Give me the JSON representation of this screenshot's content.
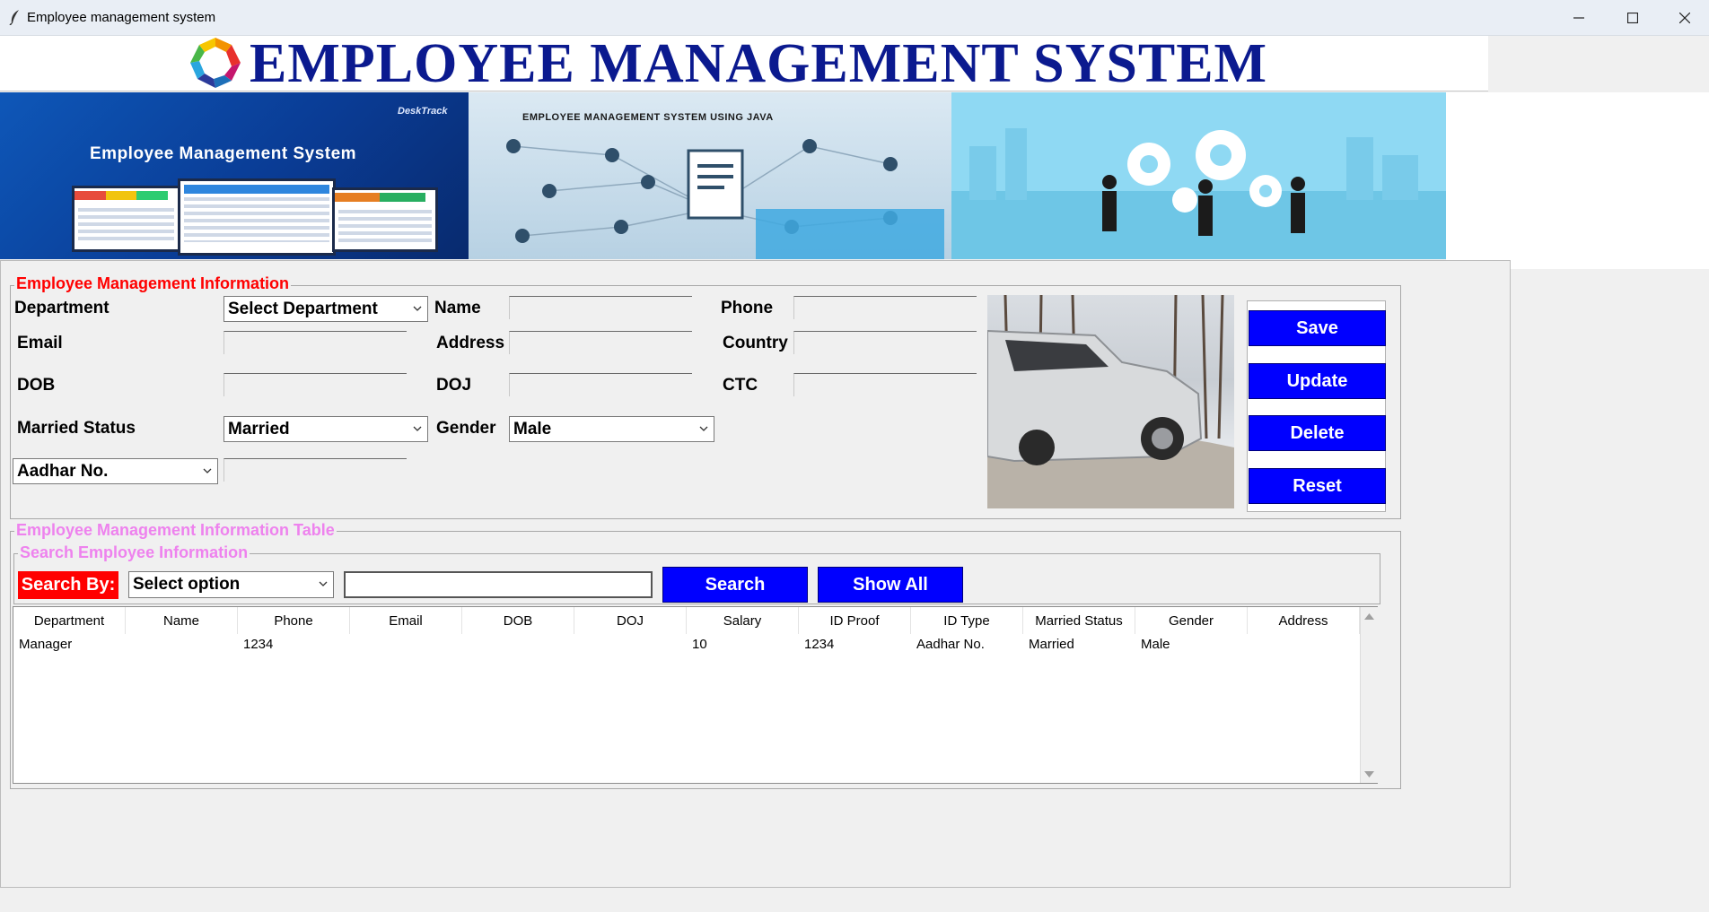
{
  "window": {
    "title": "Employee management system",
    "controls": [
      "minimize",
      "maximize",
      "close"
    ]
  },
  "header": {
    "title": "EMPLOYEE MANAGEMENT SYSTEM"
  },
  "banners": {
    "banner1_caption": "Employee Management System",
    "banner1_brand": "DeskTrack",
    "banner2_caption": "EMPLOYEE MANAGEMENT SYSTEM USING JAVA"
  },
  "form": {
    "legend": "Employee Management Information",
    "labels": {
      "department": "Department",
      "name": "Name",
      "phone": "Phone",
      "email": "Email",
      "address": "Address",
      "country": "Country",
      "dob": "DOB",
      "doj": "DOJ",
      "ctc": "CTC",
      "married_status": "Married Status",
      "gender": "Gender"
    },
    "values": {
      "department": "Select Department",
      "married_status": "Married",
      "gender": "Male",
      "id_type": "Aadhar No.",
      "name": "",
      "phone": "",
      "email": "",
      "address": "",
      "country": "",
      "dob": "",
      "doj": "",
      "ctc": "",
      "id_number": ""
    }
  },
  "buttons": {
    "save": "Save",
    "update": "Update",
    "delete": "Delete",
    "reset": "Reset"
  },
  "table_section": {
    "legend": "Employee Management Information Table",
    "search_legend": "Search Employee Information",
    "search_by_label": "Search By:",
    "search_option": "Select option",
    "search_value": "",
    "search_button": "Search",
    "show_all_button": "Show All"
  },
  "table": {
    "columns": [
      "Department",
      "Name",
      "Phone",
      "Email",
      "DOB",
      "DOJ",
      "Salary",
      "ID Proof",
      "ID Type",
      "Married Status",
      "Gender",
      "Address"
    ],
    "rows": [
      [
        "Manager",
        "",
        "1234",
        "",
        "",
        "",
        "10",
        "1234",
        "Aadhar No.",
        "Married",
        "Male",
        ""
      ]
    ]
  },
  "colors": {
    "title_blue": "#0b1a8f",
    "button_blue": "#0000ff",
    "legend_red": "#ff0000",
    "legend_violet": "#ee82ee",
    "search_by_bg": "#ff0000"
  }
}
